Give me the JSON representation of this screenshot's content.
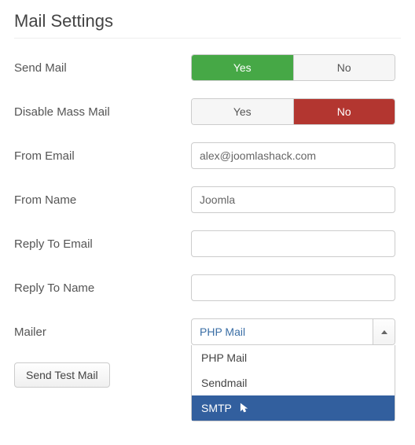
{
  "heading": "Mail Settings",
  "fields": {
    "send_mail": {
      "label": "Send Mail",
      "yes": "Yes",
      "no": "No",
      "value": "yes"
    },
    "disable_mass_mail": {
      "label": "Disable Mass Mail",
      "yes": "Yes",
      "no": "No",
      "value": "no"
    },
    "from_email": {
      "label": "From Email",
      "value": "alex@joomlashack.com"
    },
    "from_name": {
      "label": "From Name",
      "value": "Joomla"
    },
    "reply_to_email": {
      "label": "Reply To Email",
      "value": ""
    },
    "reply_to_name": {
      "label": "Reply To Name",
      "value": ""
    },
    "mailer": {
      "label": "Mailer",
      "selected": "PHP Mail",
      "options": {
        "php_mail": "PHP Mail",
        "sendmail": "Sendmail",
        "smtp": "SMTP"
      },
      "hovered": "smtp"
    }
  },
  "actions": {
    "send_test_mail": "Send Test Mail"
  }
}
